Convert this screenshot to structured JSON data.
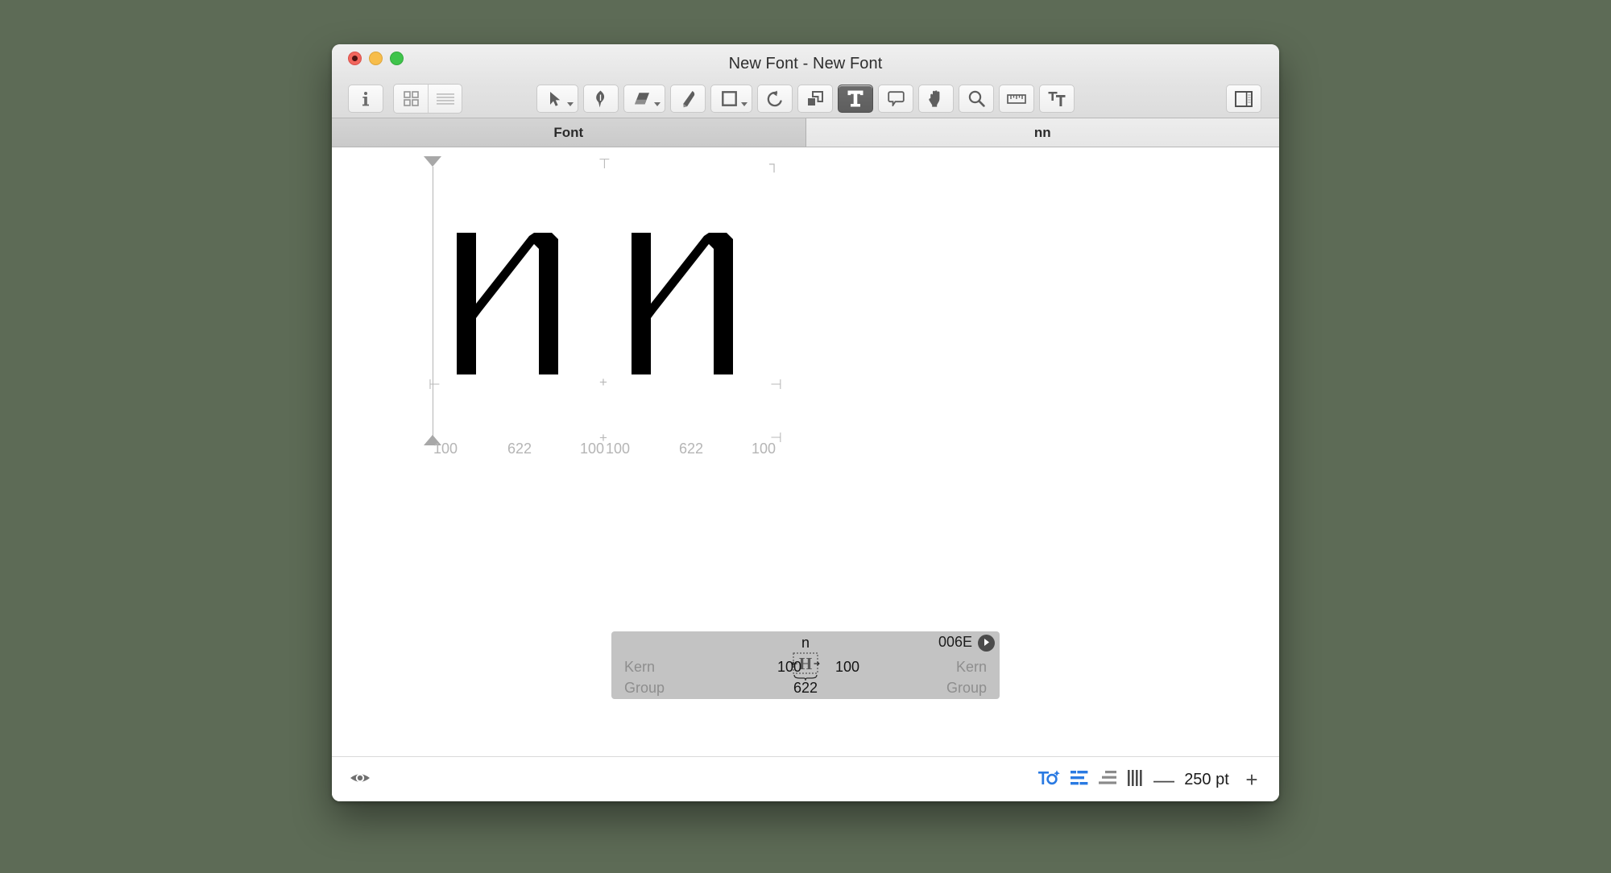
{
  "window": {
    "title": "New Font - New Font",
    "traffic_lights": [
      "close-button",
      "minimize-button",
      "maximize-button"
    ]
  },
  "toolbar": {
    "left": [
      {
        "name": "info-button",
        "icon": "info-icon"
      }
    ],
    "view_segment": [
      {
        "name": "grid-view-button",
        "icon": "grid-icon",
        "active": true
      },
      {
        "name": "list-view-button",
        "icon": "list-icon",
        "active": false
      }
    ],
    "tools": [
      {
        "name": "select-tool",
        "icon": "arrow-cursor-icon",
        "has_menu": true,
        "active": false
      },
      {
        "name": "pen-tool",
        "icon": "pen-nib-icon",
        "has_menu": false,
        "active": false
      },
      {
        "name": "eraser-tool",
        "icon": "eraser-icon",
        "has_menu": true,
        "active": false
      },
      {
        "name": "pencil-tool",
        "icon": "pencil-icon",
        "has_menu": false,
        "active": false
      },
      {
        "name": "shape-tool",
        "icon": "rectangle-icon",
        "has_menu": true,
        "active": false
      },
      {
        "name": "rotate-tool",
        "icon": "rotate-ccw-icon",
        "has_menu": false,
        "active": false
      },
      {
        "name": "transform-tool",
        "icon": "scale-transform-icon",
        "has_menu": false,
        "active": false
      },
      {
        "name": "text-tool",
        "icon": "text-T-icon",
        "has_menu": false,
        "active": true
      },
      {
        "name": "annotation-tool",
        "icon": "speech-bubble-icon",
        "has_menu": false,
        "active": false
      },
      {
        "name": "hand-tool",
        "icon": "hand-icon",
        "has_menu": false,
        "active": false
      },
      {
        "name": "zoom-tool",
        "icon": "magnifier-icon",
        "has_menu": false,
        "active": false
      },
      {
        "name": "measure-tool",
        "icon": "ruler-icon",
        "has_menu": false,
        "active": false
      },
      {
        "name": "kern-tool",
        "icon": "text-kerning-icon",
        "has_menu": false,
        "active": false
      }
    ],
    "right": [
      {
        "name": "toggle-inspector-button",
        "icon": "sidebar-panel-icon"
      }
    ]
  },
  "tabs": [
    {
      "label": "Font",
      "active": false
    },
    {
      "label": "nn",
      "active": true
    }
  ],
  "canvas": {
    "text_preview": "nn",
    "glyph_shape": "angular-n",
    "metrics_labels": [
      "100",
      "622",
      "100",
      "100",
      "622",
      "100"
    ],
    "guides": {
      "ascender_marker": "triangle-down",
      "descender_marker": "triangle-up",
      "baseline_marks": "plus-tick",
      "cap_marks": "corner-tick"
    }
  },
  "info_panel": {
    "glyph_name": "n",
    "unicode": "006E",
    "goto_icon": "arrow-right-circle-icon",
    "sidebearing_icon": "H-sidebearing-icon",
    "left_kern_label": "Kern",
    "left_group_label": "Group",
    "right_kern_label": "Kern",
    "right_group_label": "Group",
    "left_kern_value": "100",
    "right_kern_value": "100",
    "width_value": "622"
  },
  "status_bar": {
    "preview_icon": "eye-icon",
    "buttons": [
      {
        "name": "text-spacing-button",
        "icon": "To-sparkle-icon",
        "color": "#2a7ae2",
        "active": true
      },
      {
        "name": "align-left-button",
        "icon": "align-left-icon",
        "color": "#2a7ae2",
        "active": true
      },
      {
        "name": "align-right-button",
        "icon": "align-right-icon",
        "color": "#8a8a8a",
        "active": false
      },
      {
        "name": "vertical-bars-button",
        "icon": "vertical-bars-icon",
        "color": "#4a4a4a",
        "active": false
      }
    ],
    "zoom_out_label": "—",
    "zoom_value": "250 pt",
    "zoom_in_label": "+"
  },
  "colors": {
    "accent": "#2a7ae2",
    "desktop": "#5d6b56",
    "panel": "#c3c3c3",
    "guide": "#b4b4b4"
  }
}
